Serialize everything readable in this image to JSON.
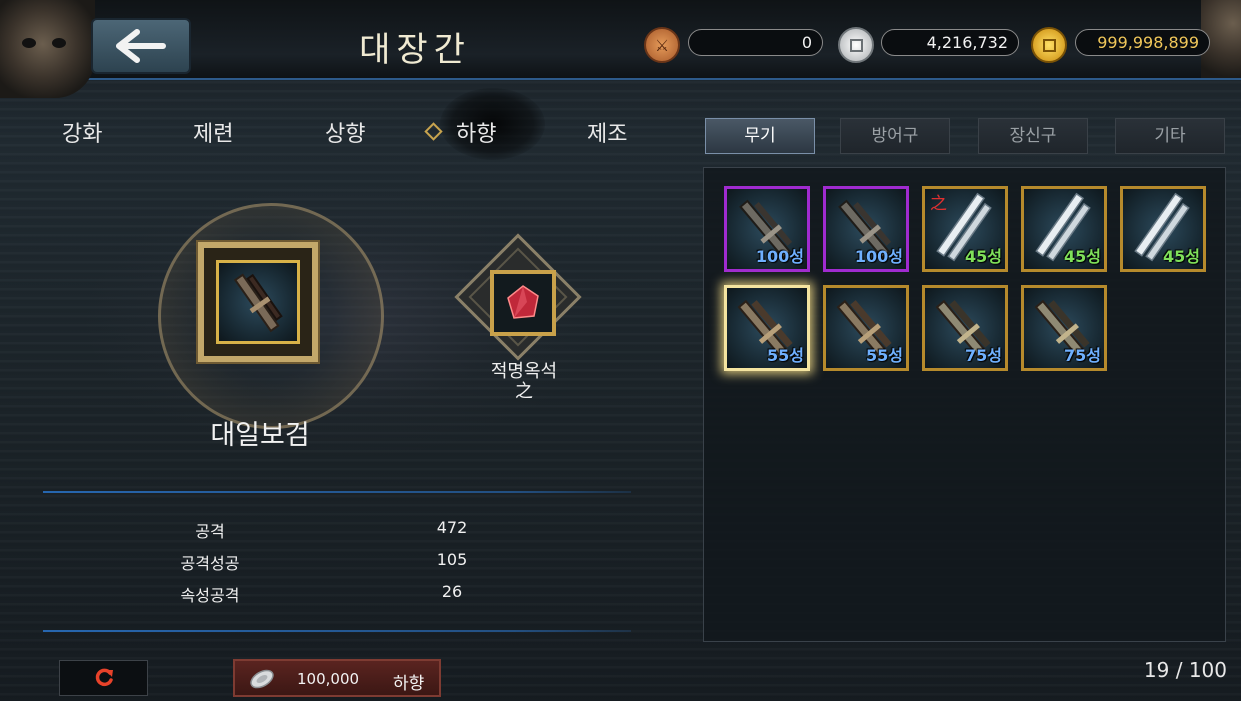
{
  "header": {
    "title": "대장간",
    "currencies": [
      {
        "icon": "bronze-coin-icon",
        "value": "0",
        "color": "#c8763a"
      },
      {
        "icon": "silver-coin-icon",
        "value": "4,216,732",
        "color": "#cfd2d4"
      },
      {
        "icon": "gold-coin-icon",
        "value": "999,998,899",
        "color": "#e6b21c"
      }
    ]
  },
  "craft_tabs": [
    {
      "label": "강화"
    },
    {
      "label": "제련"
    },
    {
      "label": "상향"
    },
    {
      "label": "하향",
      "active": true
    },
    {
      "label": "제조"
    }
  ],
  "category_tabs": [
    {
      "label": "무기",
      "active": true
    },
    {
      "label": "방어구"
    },
    {
      "label": "장신구"
    },
    {
      "label": "기타"
    }
  ],
  "selected_item": {
    "name": "대일보검",
    "icon": "sword-and-scabbard-icon"
  },
  "material": {
    "name_line1": "적명옥석",
    "name_line2": "之",
    "icon": "red-gem-icon"
  },
  "stats": [
    {
      "label": "공격",
      "value": "472"
    },
    {
      "label": "공격성공",
      "value": "105"
    },
    {
      "label": "속성공격",
      "value": "26"
    }
  ],
  "inventory": {
    "items": [
      {
        "level": "100성",
        "frame": "purple",
        "level_color": "#6fb0ff",
        "icon": "dark-blade-icon"
      },
      {
        "level": "100성",
        "frame": "purple",
        "level_color": "#6fb0ff",
        "icon": "dark-blade-icon"
      },
      {
        "level": "45성",
        "frame": "gold",
        "level_color": "#7fe05a",
        "icon": "silver-blade-icon",
        "tag": "之"
      },
      {
        "level": "45성",
        "frame": "gold",
        "level_color": "#7fe05a",
        "icon": "silver-blade-icon"
      },
      {
        "level": "45성",
        "frame": "gold",
        "level_color": "#7fe05a",
        "icon": "silver-blade-icon"
      },
      {
        "level": "55성",
        "frame": "selected",
        "level_color": "#6fb0ff",
        "icon": "ornate-sword-icon"
      },
      {
        "level": "55성",
        "frame": "gold",
        "level_color": "#6fb0ff",
        "icon": "ornate-sword-icon"
      },
      {
        "level": "75성",
        "frame": "gold",
        "level_color": "#6fb0ff",
        "icon": "ornate-sword-icon"
      },
      {
        "level": "75성",
        "frame": "gold",
        "level_color": "#6fb0ff",
        "icon": "ornate-sword-icon"
      }
    ],
    "count": "19 / 100"
  },
  "footer": {
    "reset_icon": "refresh-icon",
    "action_cost": "100,000",
    "action_label": "하향",
    "action_icon": "silver-ingot-icon"
  }
}
